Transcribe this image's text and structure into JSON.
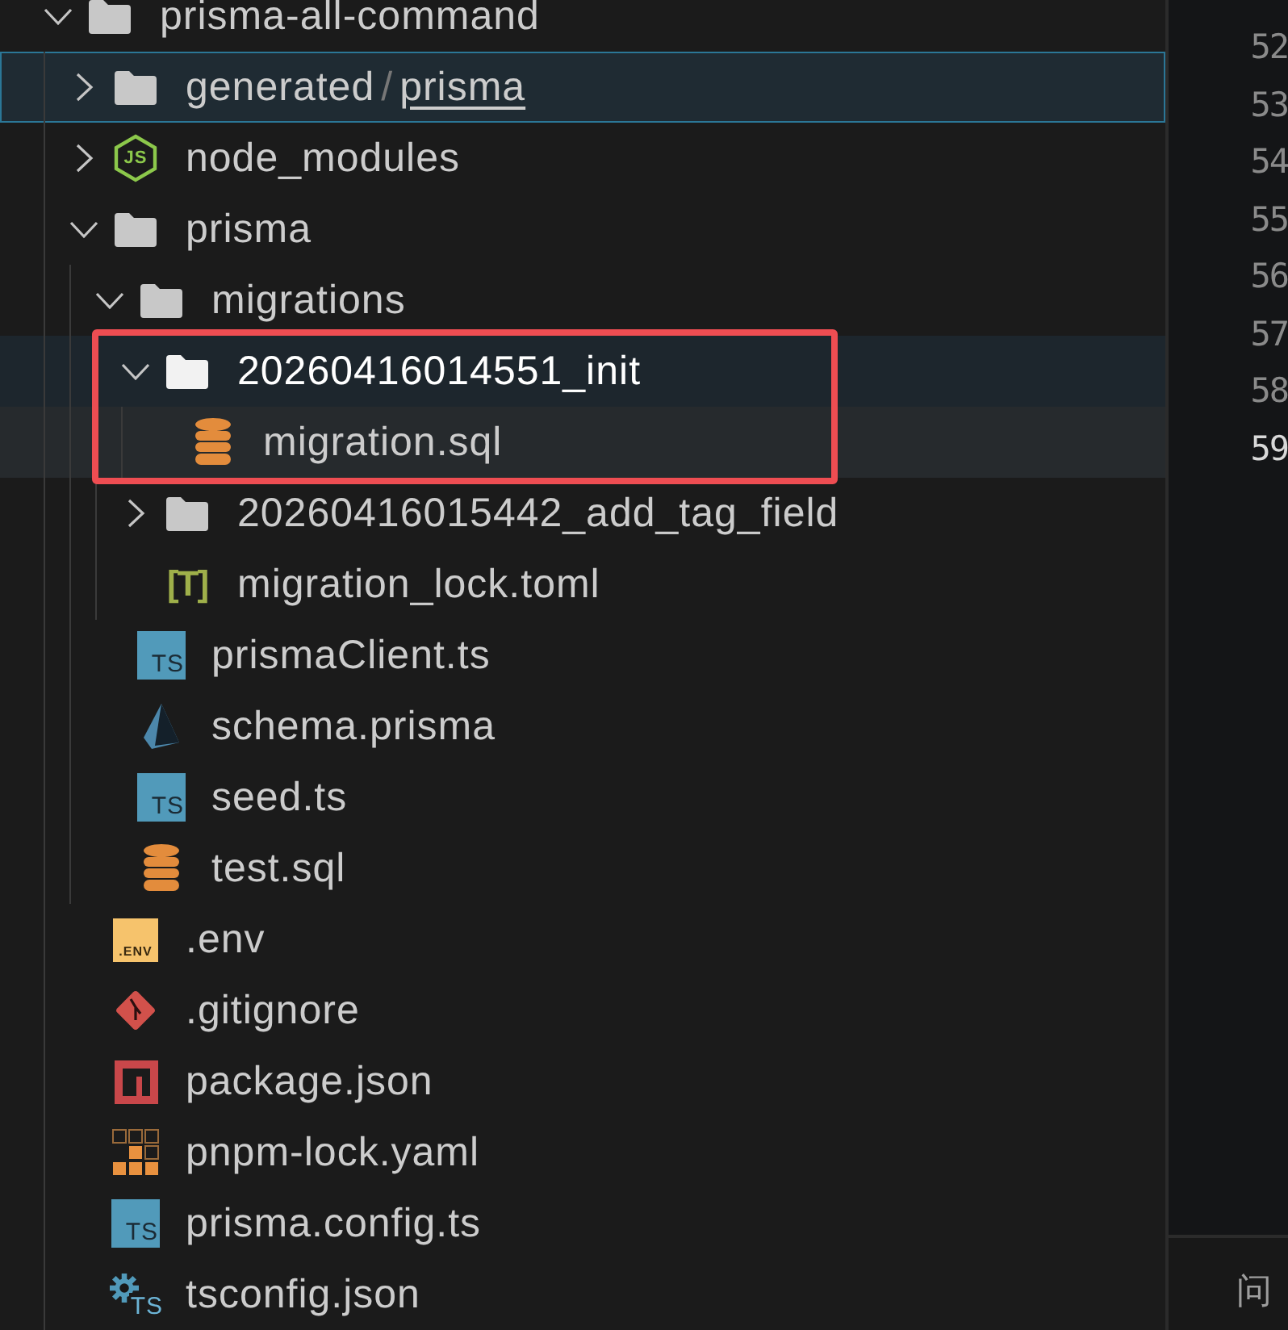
{
  "explorer": {
    "tree": [
      {
        "kind": "folder",
        "label": "prisma-all-command",
        "expanded": true,
        "selected": false,
        "focused": false,
        "hovered": false,
        "highlighted": false,
        "children": [
          {
            "kind": "folder",
            "label_parts": [
              "generated",
              "prisma"
            ],
            "separator": "/",
            "expanded": false,
            "selected": false,
            "focused": true,
            "hovered": false,
            "highlighted": false
          },
          {
            "kind": "node-folder",
            "label": "node_modules",
            "icon_text": "JS",
            "expanded": false,
            "selected": false,
            "focused": false,
            "hovered": false,
            "highlighted": false
          },
          {
            "kind": "folder",
            "label": "prisma",
            "expanded": true,
            "selected": false,
            "focused": false,
            "hovered": false,
            "highlighted": false,
            "children": [
              {
                "kind": "folder",
                "label": "migrations",
                "expanded": true,
                "selected": false,
                "focused": false,
                "hovered": false,
                "highlighted": false,
                "children": [
                  {
                    "kind": "folder",
                    "label": "20260416014551_init",
                    "expanded": true,
                    "selected": true,
                    "focused": false,
                    "hovered": false,
                    "highlighted": true,
                    "children": [
                      {
                        "kind": "sql",
                        "label": "migration.sql",
                        "selected": false,
                        "focused": false,
                        "hovered": true,
                        "highlighted": true
                      }
                    ]
                  },
                  {
                    "kind": "folder",
                    "label": "20260416015442_add_tag_field",
                    "expanded": false,
                    "selected": false,
                    "focused": false,
                    "hovered": false,
                    "highlighted": false
                  },
                  {
                    "kind": "toml",
                    "label": "migration_lock.toml",
                    "icon_text": "[T]",
                    "selected": false,
                    "focused": false,
                    "hovered": false,
                    "highlighted": false
                  }
                ]
              },
              {
                "kind": "ts",
                "label": "prismaClient.ts",
                "icon_text": "TS",
                "selected": false,
                "focused": false,
                "hovered": false,
                "highlighted": false
              },
              {
                "kind": "prisma",
                "label": "schema.prisma",
                "selected": false,
                "focused": false,
                "hovered": false,
                "highlighted": false
              },
              {
                "kind": "ts",
                "label": "seed.ts",
                "icon_text": "TS",
                "selected": false,
                "focused": false,
                "hovered": false,
                "highlighted": false
              },
              {
                "kind": "sql",
                "label": "test.sql",
                "selected": false,
                "focused": false,
                "hovered": false,
                "highlighted": false
              }
            ]
          },
          {
            "kind": "env",
            "label": ".env",
            "icon_text": ".ENV",
            "selected": false,
            "focused": false,
            "hovered": false,
            "highlighted": false
          },
          {
            "kind": "git",
            "label": ".gitignore",
            "selected": false,
            "focused": false,
            "hovered": false,
            "highlighted": false
          },
          {
            "kind": "npm",
            "label": "package.json",
            "selected": false,
            "focused": false,
            "hovered": false,
            "highlighted": false
          },
          {
            "kind": "pnpm",
            "label": "pnpm-lock.yaml",
            "selected": false,
            "focused": false,
            "hovered": false,
            "highlighted": false
          },
          {
            "kind": "ts",
            "label": "prisma.config.ts",
            "icon_text": "TS",
            "selected": false,
            "focused": false,
            "hovered": false,
            "highlighted": false
          },
          {
            "kind": "tsconfig",
            "label": "tsconfig.json",
            "icon_text": "TS",
            "selected": false,
            "focused": false,
            "hovered": false,
            "highlighted": false
          }
        ]
      }
    ]
  },
  "editor": {
    "line_numbers": [
      {
        "text": "52",
        "current": false
      },
      {
        "text": "53",
        "current": false
      },
      {
        "text": "54",
        "current": false
      },
      {
        "text": "55",
        "current": false
      },
      {
        "text": "56",
        "current": false
      },
      {
        "text": "57",
        "current": false
      },
      {
        "text": "58",
        "current": false
      },
      {
        "text": "59",
        "current": true
      }
    ]
  },
  "panel": {
    "tab": "问"
  }
}
